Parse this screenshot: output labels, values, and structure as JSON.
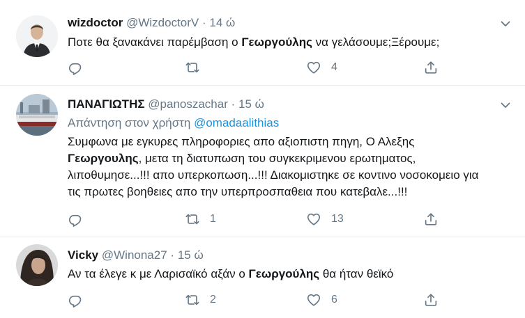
{
  "tweets": [
    {
      "name": "wizdoctor",
      "handle": "@WizdoctorV",
      "dot": "·",
      "time": "14 ώ",
      "text_parts": [
        "Ποτε θα ξανακάνει παρέμβαση ο ",
        "Γεωργούλης",
        " να γελάσουμε;Ξέρουμε;"
      ],
      "retweets": "",
      "likes": "4"
    },
    {
      "name": "ΠΑΝΑΓΙΩΤΗΣ",
      "handle": "@panoszachar",
      "dot": "·",
      "time": "15 ώ",
      "reply_prefix": "Απάντηση στον χρήστη ",
      "reply_handle": "@omadaalithias",
      "text_parts": [
        "Συμφωνα με εγκυρες πληροφοριες απο αξιοπιστη πηγη, Ο Αλεξης ",
        "Γεωργουλης",
        ", μετα τη διατυπωση του συγκεκριμενου ερωτηματος, λιποθυμησε...!!! απο υπερκοπωση...!!! Διακομιστηκε σε κοντινο νοσοκομειο για τις πρωτες βοηθειες απο την υπερπροσπαθεια που κατεβαλε...!!!"
      ],
      "retweets": "1",
      "likes": "13"
    },
    {
      "name": "Vicky",
      "handle": "@Winona27",
      "dot": "·",
      "time": "15 ώ",
      "text_parts": [
        "Αν τα έλεγε κ με Λαρισαϊκό αξάν ο ",
        "Γεωργούλης",
        " θα ήταν θεϊκό"
      ],
      "retweets": "2",
      "likes": "6"
    }
  ],
  "icons": {
    "reply": "reply-icon",
    "retweet": "retweet-icon",
    "like": "heart-icon",
    "share": "share-icon",
    "menu": "chevron-down-icon"
  },
  "colors": {
    "link": "#1b95e0",
    "muted": "#657786",
    "text": "#14171a",
    "border": "#e6ecf0"
  }
}
